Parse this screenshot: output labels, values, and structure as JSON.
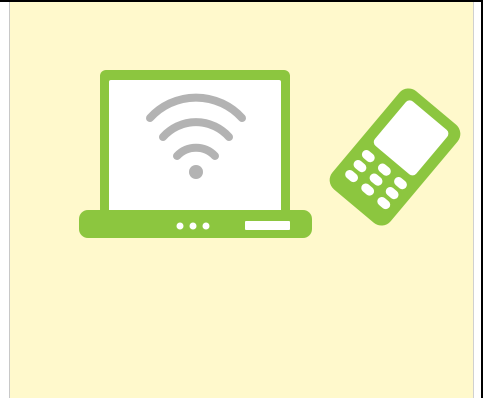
{
  "scene": {
    "background_color": "#fff9cc",
    "accent_green": "#8cc63f",
    "wifi_gray": "#b3b3b3",
    "screen_white": "#ffffff",
    "icons": [
      "laptop-icon",
      "wifi-icon",
      "mobile-phone-icon"
    ]
  }
}
